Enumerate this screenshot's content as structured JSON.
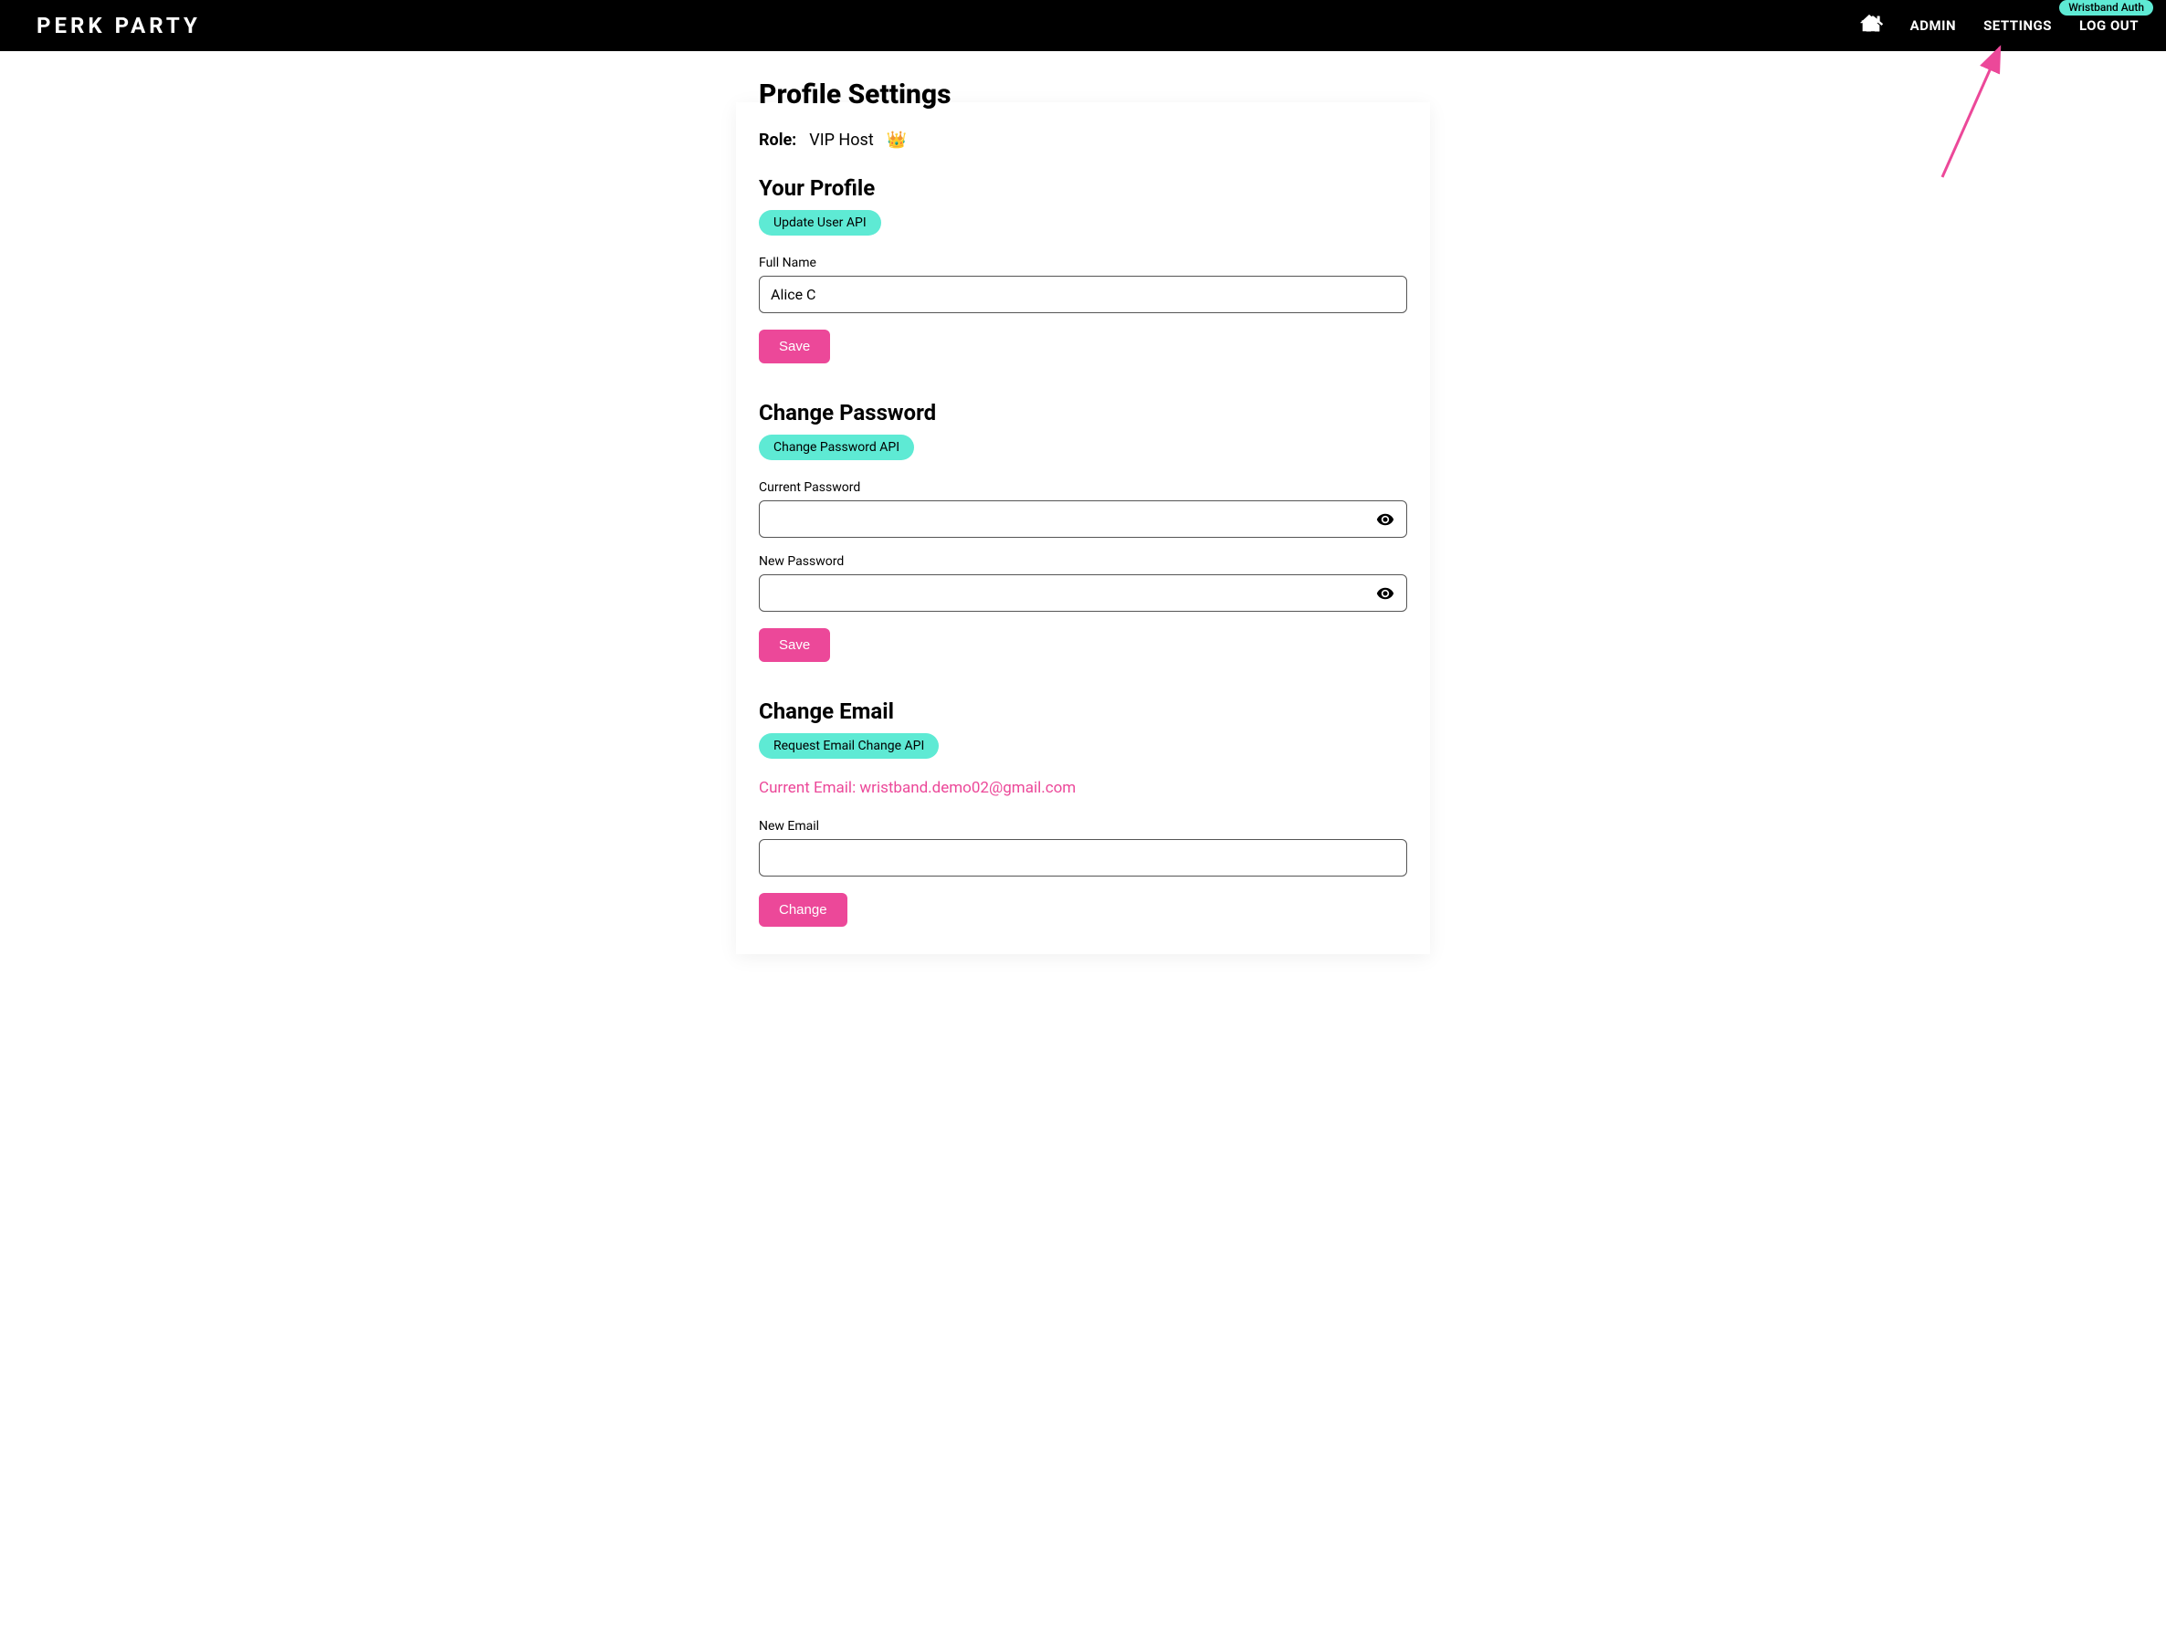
{
  "banner": {
    "label": "Wristband Auth"
  },
  "nav": {
    "brand": "PERK PARTY",
    "admin": "ADMIN",
    "settings": "SETTINGS",
    "logout": "LOG OUT"
  },
  "page": {
    "title": "Profile Settings",
    "role_label": "Role:",
    "role_value": "VIP Host",
    "crown": "👑"
  },
  "profile": {
    "heading": "Your Profile",
    "api_chip": "Update User API",
    "fullname_label": "Full Name",
    "fullname_value": "Alice C",
    "save": "Save"
  },
  "password": {
    "heading": "Change Password",
    "api_chip": "Change Password API",
    "current_label": "Current Password",
    "current_value": "",
    "new_label": "New Password",
    "new_value": "",
    "save": "Save"
  },
  "email": {
    "heading": "Change Email",
    "api_chip": "Request Email Change API",
    "current_email_prefix": "Current Email: ",
    "current_email_value": "wristband.demo02@gmail.com",
    "new_label": "New Email",
    "new_value": "",
    "change": "Change"
  }
}
